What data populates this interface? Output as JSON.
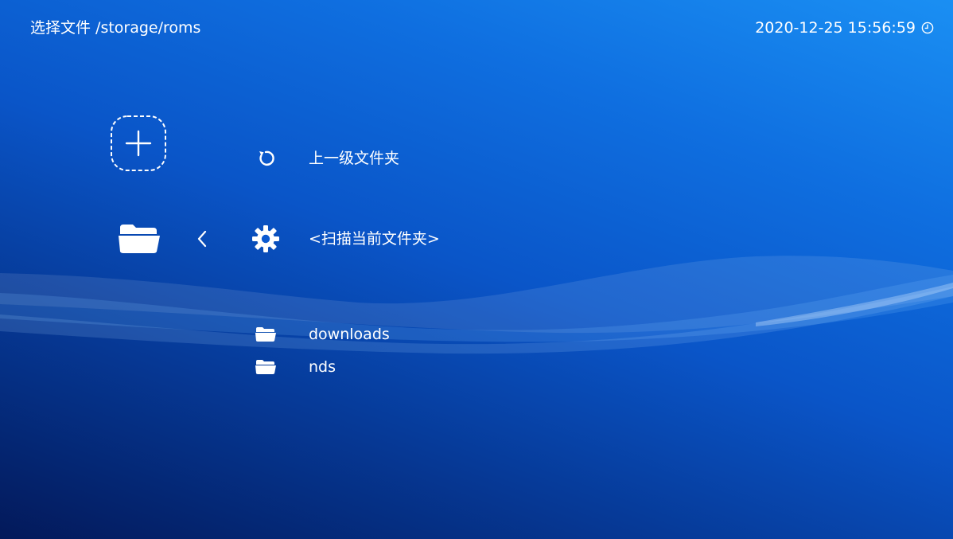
{
  "header": {
    "title": "选择文件 /storage/roms",
    "clock": "2020-12-25 15:56:59",
    "clock_icon": "clock-icon"
  },
  "sidebar": {
    "add_icon": "plus-icon",
    "folder_icon": "folder-icon",
    "back_icon": "chevron-left-icon"
  },
  "entries": [
    {
      "label": "上一级文件夹",
      "icon": "refresh-icon"
    },
    {
      "label": "<扫描当前文件夹>",
      "icon": "gear-icon"
    },
    {
      "label": "downloads",
      "icon": "folder-icon"
    },
    {
      "label": "nds",
      "icon": "folder-icon"
    }
  ],
  "colors": {
    "text": "#ffffff",
    "background_top": "#1a8ff3",
    "background_bottom": "#03195a"
  }
}
